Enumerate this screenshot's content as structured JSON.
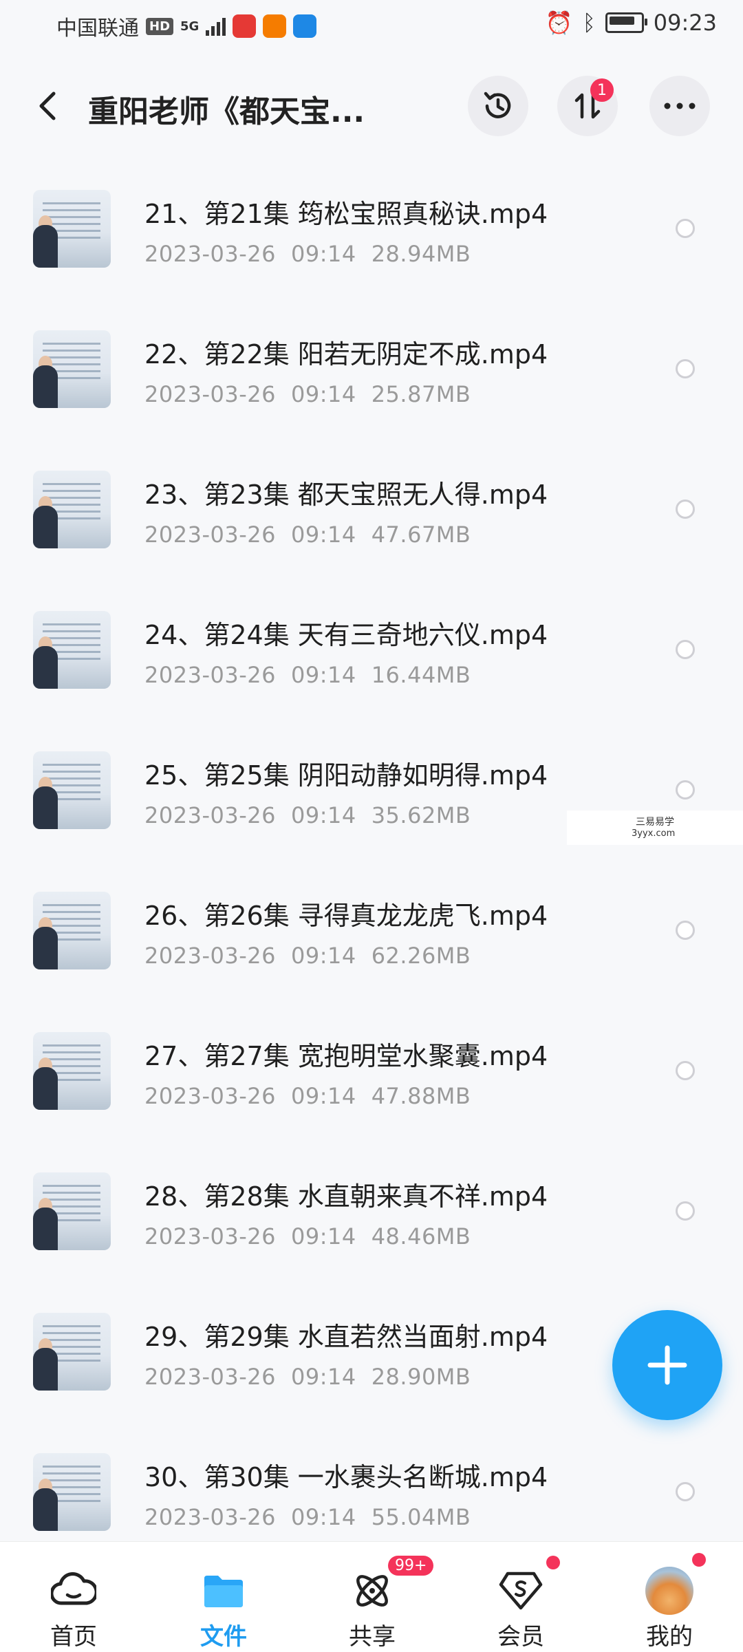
{
  "status_bar": {
    "carrier": "中国联通",
    "hd": "HD",
    "network": "5G",
    "time": "09:23"
  },
  "header": {
    "title": "重阳老师《都天宝...",
    "transfer_badge": "1"
  },
  "files": [
    {
      "name": "21、第21集 筠松宝照真秘诀.mp4",
      "date": "2023-03-26",
      "time": "09:14",
      "size": "28.94MB"
    },
    {
      "name": "22、第22集 阳若无阴定不成.mp4",
      "date": "2023-03-26",
      "time": "09:14",
      "size": "25.87MB"
    },
    {
      "name": "23、第23集 都天宝照无人得.mp4",
      "date": "2023-03-26",
      "time": "09:14",
      "size": "47.67MB"
    },
    {
      "name": "24、第24集 天有三奇地六仪.mp4",
      "date": "2023-03-26",
      "time": "09:14",
      "size": "16.44MB"
    },
    {
      "name": "25、第25集 阴阳动静如明得.mp4",
      "date": "2023-03-26",
      "time": "09:14",
      "size": "35.62MB"
    },
    {
      "name": "26、第26集 寻得真龙龙虎飞.mp4",
      "date": "2023-03-26",
      "time": "09:14",
      "size": "62.26MB"
    },
    {
      "name": "27、第27集 宽抱明堂水聚囊.mp4",
      "date": "2023-03-26",
      "time": "09:14",
      "size": "47.88MB"
    },
    {
      "name": "28、第28集 水直朝来真不祥.mp4",
      "date": "2023-03-26",
      "time": "09:14",
      "size": "48.46MB"
    },
    {
      "name": "29、第29集 水直若然当面射.mp4",
      "date": "2023-03-26",
      "time": "09:14",
      "size": "28.90MB"
    },
    {
      "name": "30、第30集 一水裹头名断城.mp4",
      "date": "2023-03-26",
      "time": "09:14",
      "size": "55.04MB"
    }
  ],
  "watermark": {
    "line1": "三易易学",
    "line2": "3yyx.com"
  },
  "nav": {
    "home": "首页",
    "files": "文件",
    "share": "共享",
    "share_badge": "99+",
    "vip": "会员",
    "mine": "我的"
  },
  "colors": {
    "accent": "#1fa3f5",
    "badge": "#f4335a"
  }
}
